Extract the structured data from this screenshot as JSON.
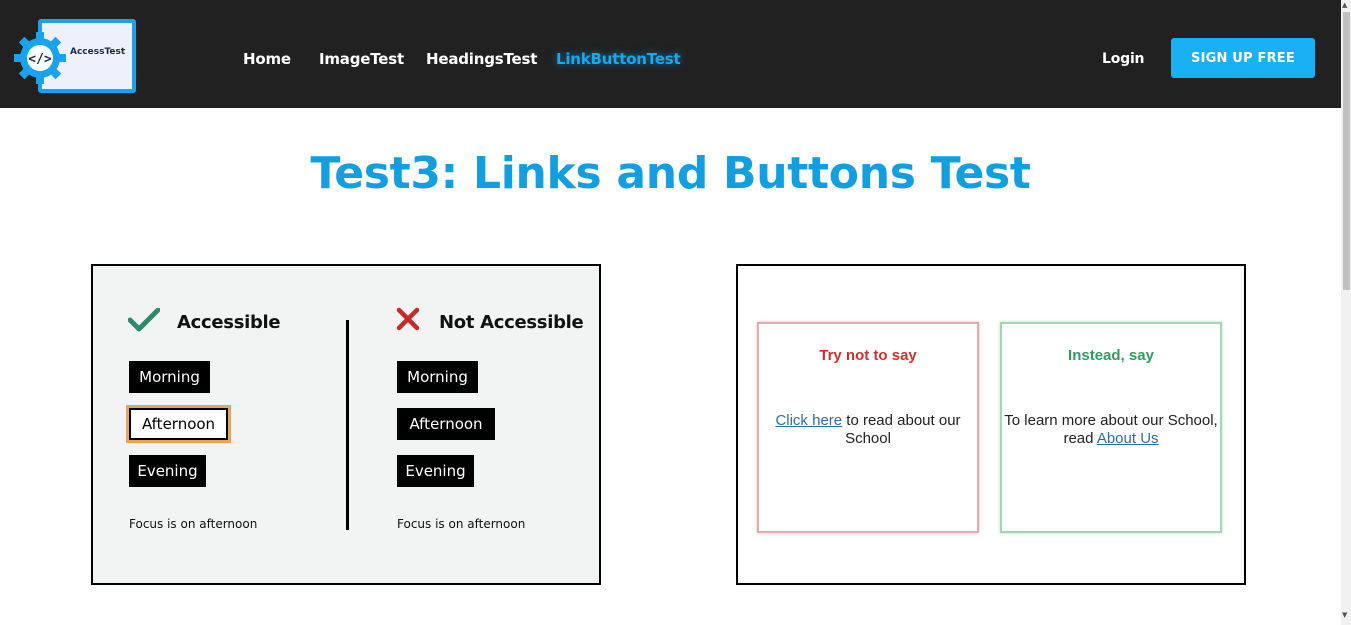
{
  "header": {
    "logo_text": "AccessTest",
    "nav": [
      "Home",
      "ImageTest",
      "HeadingsTest",
      "LinkButtonTest"
    ],
    "active_nav": "LinkButtonTest",
    "login_label": "Login",
    "signup_label": "SIGN UP FREE"
  },
  "main": {
    "title": "Test3: Links and Buttons Test"
  },
  "left_image": {
    "accessible": {
      "heading": "Accessible",
      "buttons": [
        "Morning",
        "Afternoon",
        "Evening"
      ],
      "focused_button": "Afternoon",
      "note": "Focus is on afternoon"
    },
    "not_accessible": {
      "heading": "Not Accessible",
      "buttons": [
        "Morning",
        "Afternoon",
        "Evening"
      ],
      "note": "Focus is on afternoon"
    }
  },
  "right_image": {
    "bad": {
      "heading": "Try not to say",
      "link": "Click here",
      "text_after": " to read about our School"
    },
    "good": {
      "heading": "Instead, say",
      "text_before": "To learn more about our School, read ",
      "link": "About Us"
    }
  },
  "colors": {
    "nav_bg": "#212121",
    "accent": "#1ab0f4",
    "title": "#139fdf",
    "check": "#2e8b6e",
    "cross": "#c42b2b"
  },
  "icons": [
    "gear-logo-icon",
    "check-icon",
    "cross-icon"
  ]
}
